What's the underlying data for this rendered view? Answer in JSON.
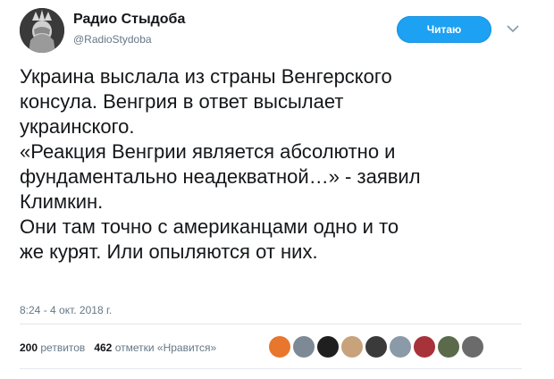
{
  "author": {
    "display_name": "Радио Стыдоба",
    "handle": "@RadioStydoba",
    "avatar_icon": "statue-of-liberty-facepalm-icon"
  },
  "follow_button": {
    "label": "Читаю"
  },
  "menu_icon": "chevron-down-icon",
  "tweet": {
    "lines": [
      "Украина выслала из страны Венгерского",
      "консула. Венгрия в ответ высылает",
      "украинского.",
      "«Реакция Венгрии является абсолютно и",
      "фундаментально неадекватной…» - заявил",
      "Климкин.",
      "Они там точно с американцами одно и то",
      "же курят. Или опыляются от них."
    ]
  },
  "timestamp": "8:24 - 4 окт. 2018 г.",
  "stats": {
    "retweets_count": "200",
    "retweets_label": "ретвитов",
    "likes_count": "462",
    "likes_label": "отметки «Нравится»"
  },
  "likers": [
    {
      "icon": "avatar-icon",
      "color": "#e8762c"
    },
    {
      "icon": "avatar-icon",
      "color": "#7d8a96"
    },
    {
      "icon": "avatar-icon",
      "color": "#1f1f1f"
    },
    {
      "icon": "avatar-icon",
      "color": "#c7a27a"
    },
    {
      "icon": "avatar-icon",
      "color": "#3a3a3a"
    },
    {
      "icon": "avatar-icon",
      "color": "#8a9aa8"
    },
    {
      "icon": "avatar-icon",
      "color": "#a8323a"
    },
    {
      "icon": "avatar-icon",
      "color": "#5a6a4a"
    },
    {
      "icon": "avatar-icon",
      "color": "#6b6b6b"
    }
  ]
}
